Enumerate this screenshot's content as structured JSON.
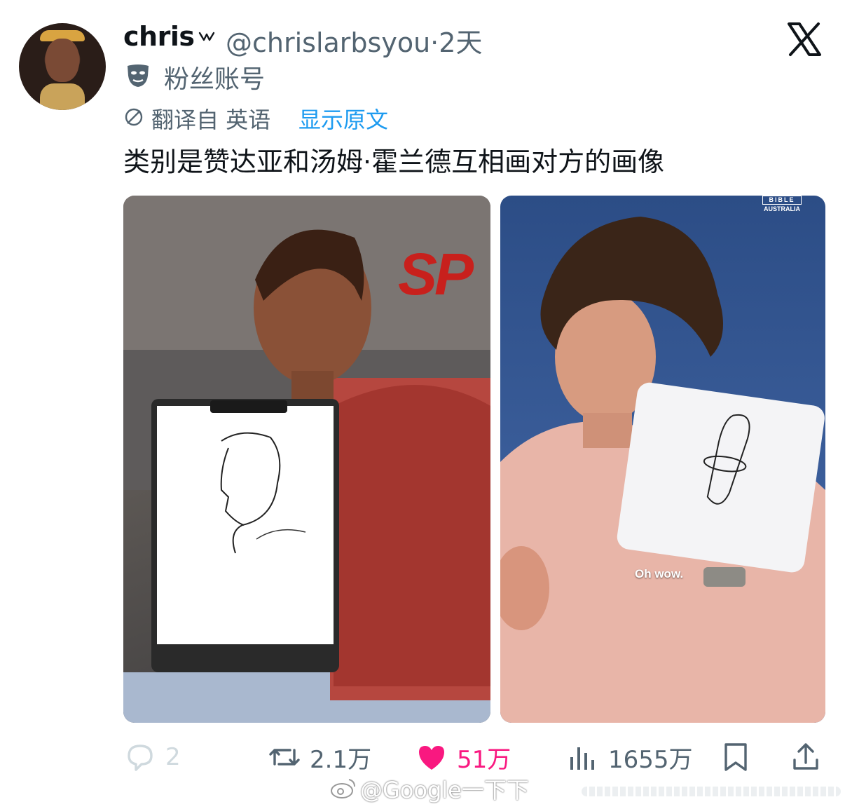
{
  "tweet": {
    "author_name": "chris",
    "author_handle": "@chrislarbsyou",
    "separator": "·",
    "time_ago": "2天",
    "account_label": "粉丝账号",
    "translated_from": "翻译自 英语",
    "show_original": "显示原文",
    "text": "类别是赞达亚和汤姆·霍兰德互相画对方的画像"
  },
  "media": {
    "left_photo": {
      "logo_text": "SP"
    },
    "right_photo": {
      "watermark_line1": "BIBLE",
      "watermark_line2": "AUSTRALIA",
      "caption": "Oh wow."
    }
  },
  "actions": {
    "reply_count": "2",
    "retweet_count": "2.1万",
    "like_count": "51万",
    "views_count": "1655万"
  },
  "overlay": {
    "weibo_watermark": "@Google一下下"
  },
  "colors": {
    "accent_blue": "#1d9bf0",
    "like_pink": "#f91880",
    "secondary_text": "#536471",
    "primary_text": "#0f1419"
  },
  "icons": [
    "verified-badge-icon",
    "x-logo-icon",
    "fan-mask-icon",
    "translate-globe-icon",
    "reply-icon",
    "retweet-icon",
    "heart-icon",
    "views-icon",
    "bookmark-icon",
    "share-icon",
    "weibo-icon"
  ]
}
